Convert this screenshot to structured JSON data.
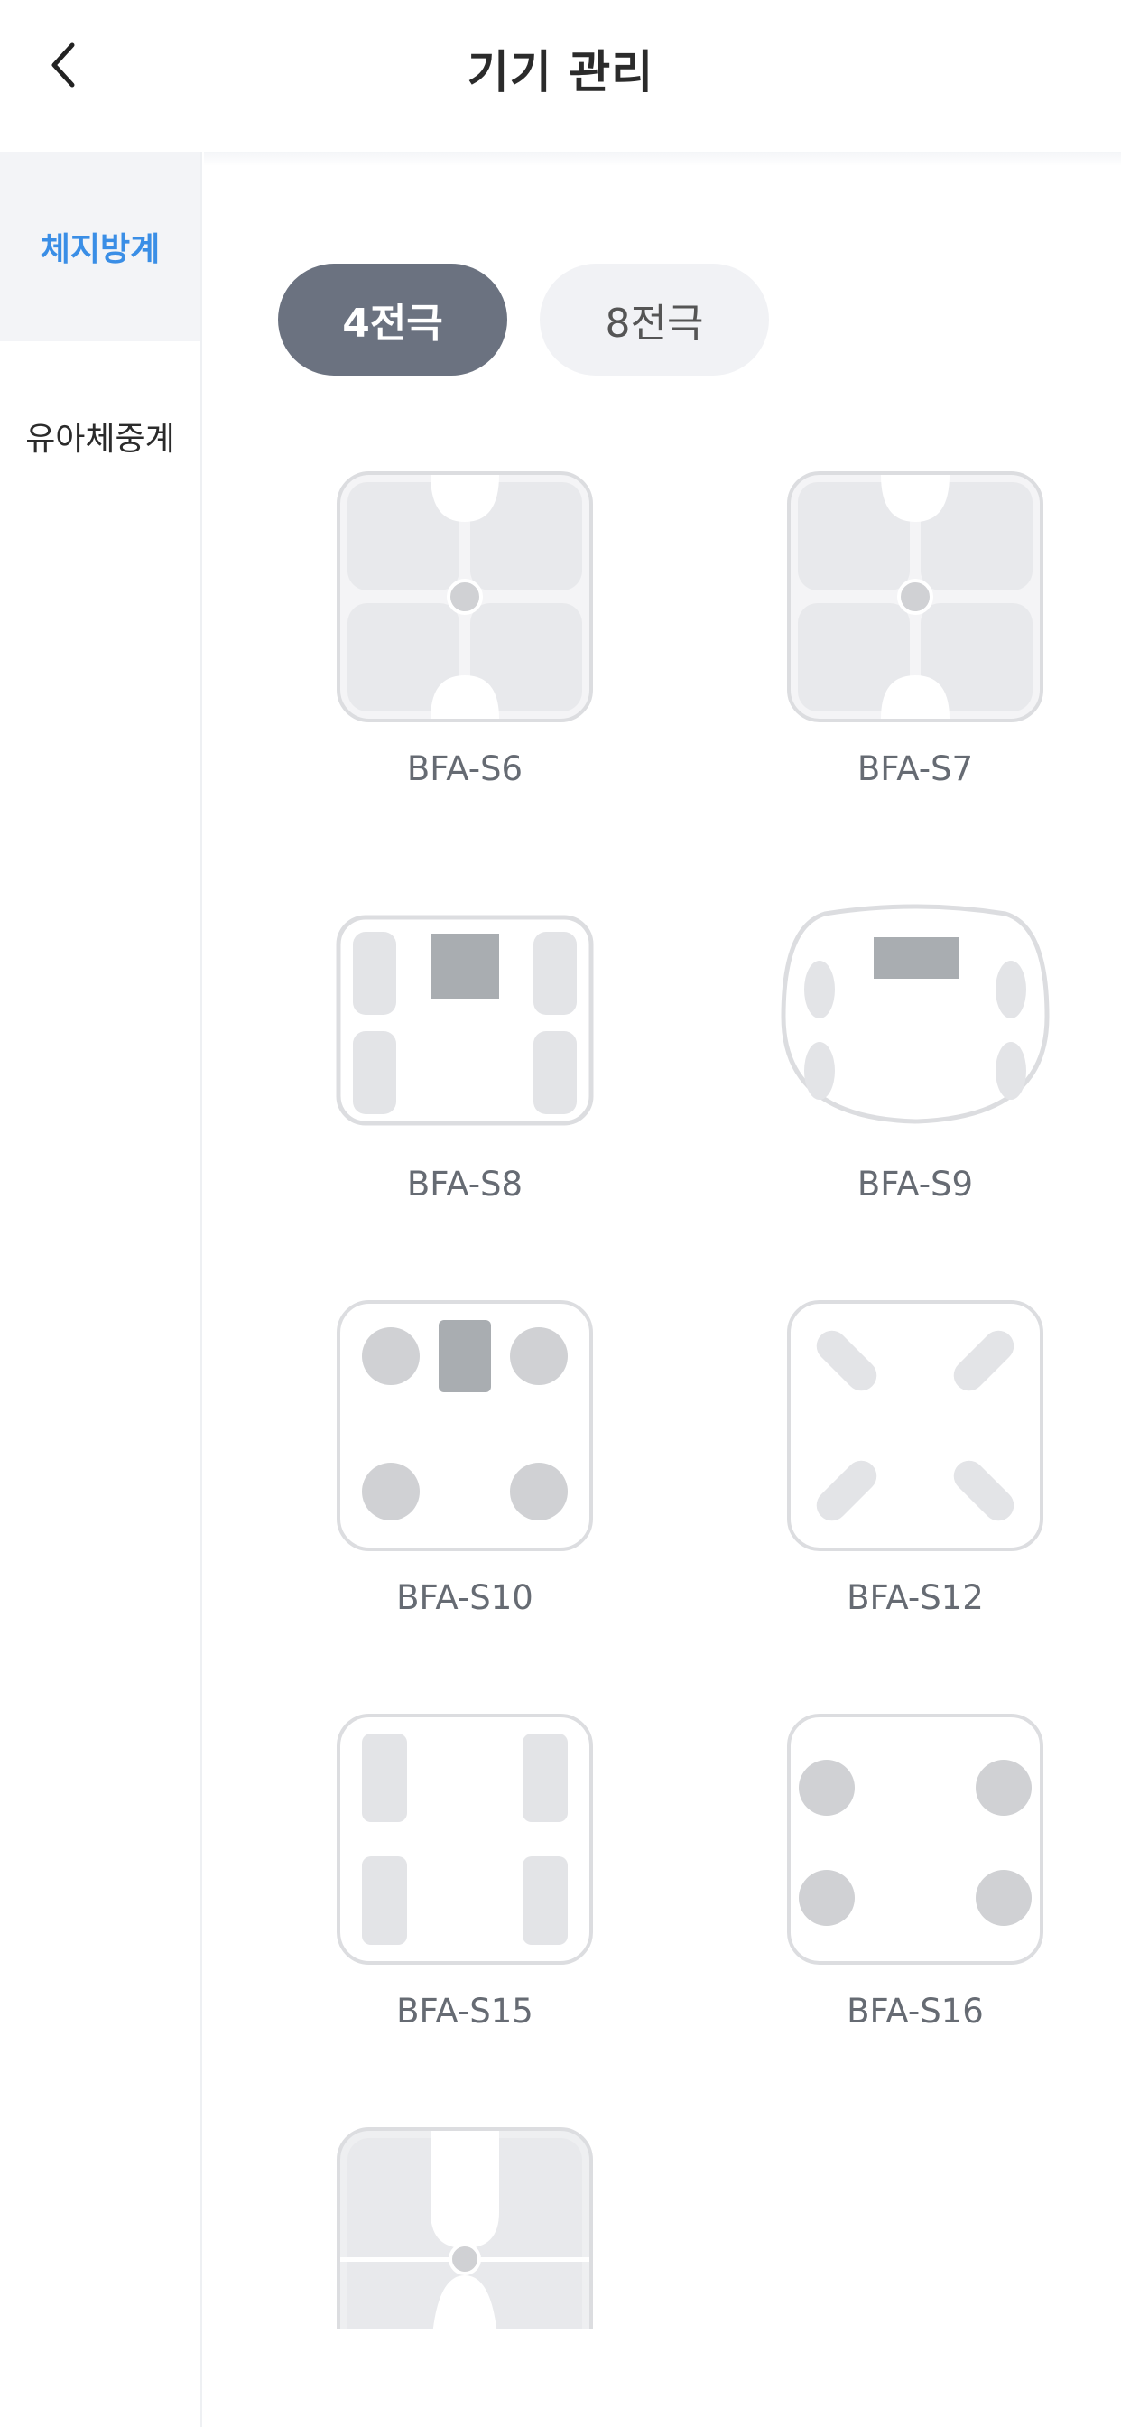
{
  "header": {
    "title": "기기 관리",
    "back_icon": "chevron-left-icon"
  },
  "sidebar": {
    "items": [
      {
        "label": "체지방계",
        "active": true
      },
      {
        "label": "유아체중계",
        "active": false
      }
    ]
  },
  "tabs": [
    {
      "label": "4전극",
      "active": true
    },
    {
      "label": "8전극",
      "active": false
    }
  ],
  "devices": [
    {
      "name": "BFA-S6",
      "style": "cross-gray"
    },
    {
      "name": "BFA-S7",
      "style": "cross-gray"
    },
    {
      "name": "BFA-S8",
      "style": "bars-display"
    },
    {
      "name": "BFA-S9",
      "style": "rounded-display"
    },
    {
      "name": "BFA-S10",
      "style": "dots-display"
    },
    {
      "name": "BFA-S12",
      "style": "diagonal-pads"
    },
    {
      "name": "BFA-S15",
      "style": "bars-plain"
    },
    {
      "name": "BFA-S16",
      "style": "dots-plain"
    },
    {
      "name": "",
      "style": "partial-cross"
    }
  ],
  "colors": {
    "accent": "#3a8ee6",
    "tab_active": "#6b7280",
    "tab_inactive": "#f1f2f5"
  }
}
